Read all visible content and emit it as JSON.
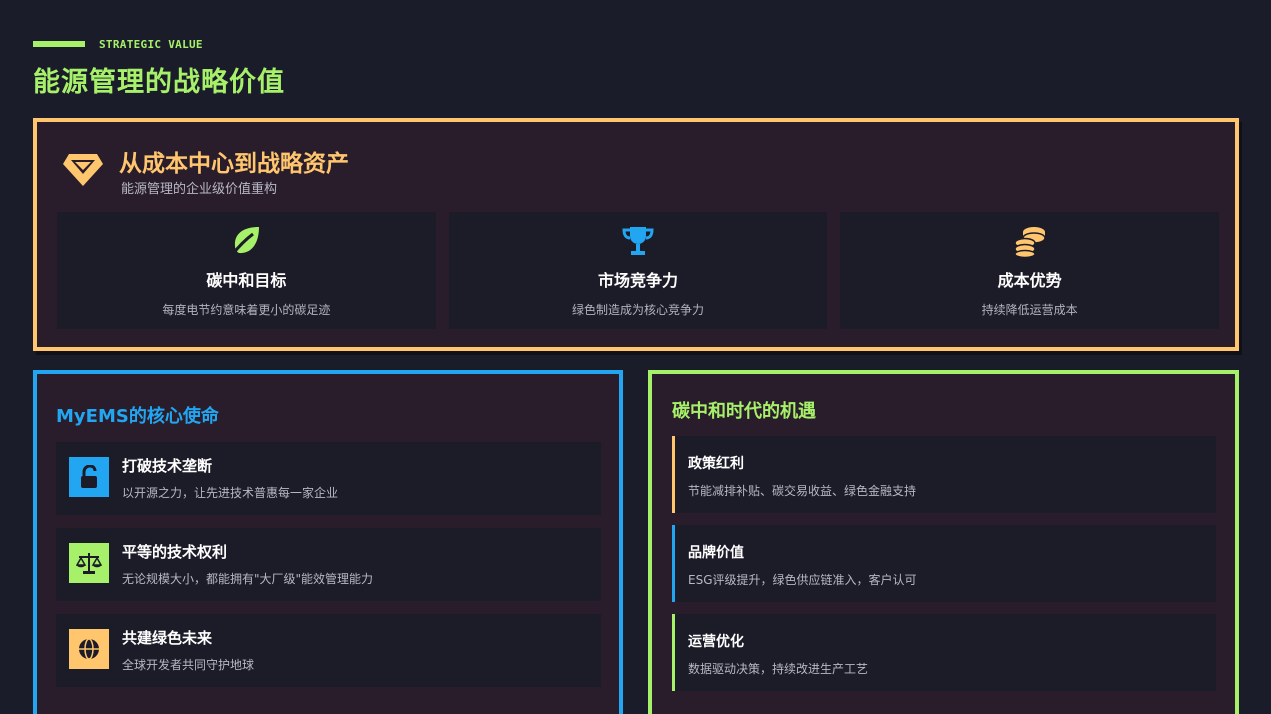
{
  "header": {
    "kicker": "STRATEGIC VALUE",
    "title": "能源管理的战略价值"
  },
  "hero": {
    "icon": "gem-icon",
    "title": "从成本中心到战略资产",
    "subtitle": "能源管理的企业级价值重构",
    "cards": [
      {
        "icon": "leaf-icon",
        "title": "碳中和目标",
        "desc": "每度电节约意味着更小的碳足迹"
      },
      {
        "icon": "trophy-icon",
        "title": "市场竞争力",
        "desc": "绿色制造成为核心竞争力"
      },
      {
        "icon": "coins-icon",
        "title": "成本优势",
        "desc": "持续降低运营成本"
      }
    ]
  },
  "mission": {
    "title": "MyEMS的核心使命",
    "items": [
      {
        "icon": "unlock-icon",
        "title": "打破技术垄断",
        "desc": "以开源之力，让先进技术普惠每一家企业"
      },
      {
        "icon": "scale-icon",
        "title": "平等的技术权利",
        "desc": "无论规模大小，都能拥有\"大厂级\"能效管理能力"
      },
      {
        "icon": "globe-icon",
        "title": "共建绿色未来",
        "desc": "全球开发者共同守护地球"
      }
    ]
  },
  "opportunity": {
    "title": "碳中和时代的机遇",
    "items": [
      {
        "title": "政策红利",
        "desc": "节能减排补贴、碳交易收益、绿色金融支持"
      },
      {
        "title": "品牌价值",
        "desc": "ESG评级提升，绿色供应链准入，客户认可"
      },
      {
        "title": "运营优化",
        "desc": "数据驱动决策，持续改进生产工艺"
      }
    ]
  },
  "colors": {
    "background": "#1b1c29",
    "green": "#a6f06a",
    "yellow": "#ffc66e",
    "blue": "#22a6f2"
  }
}
